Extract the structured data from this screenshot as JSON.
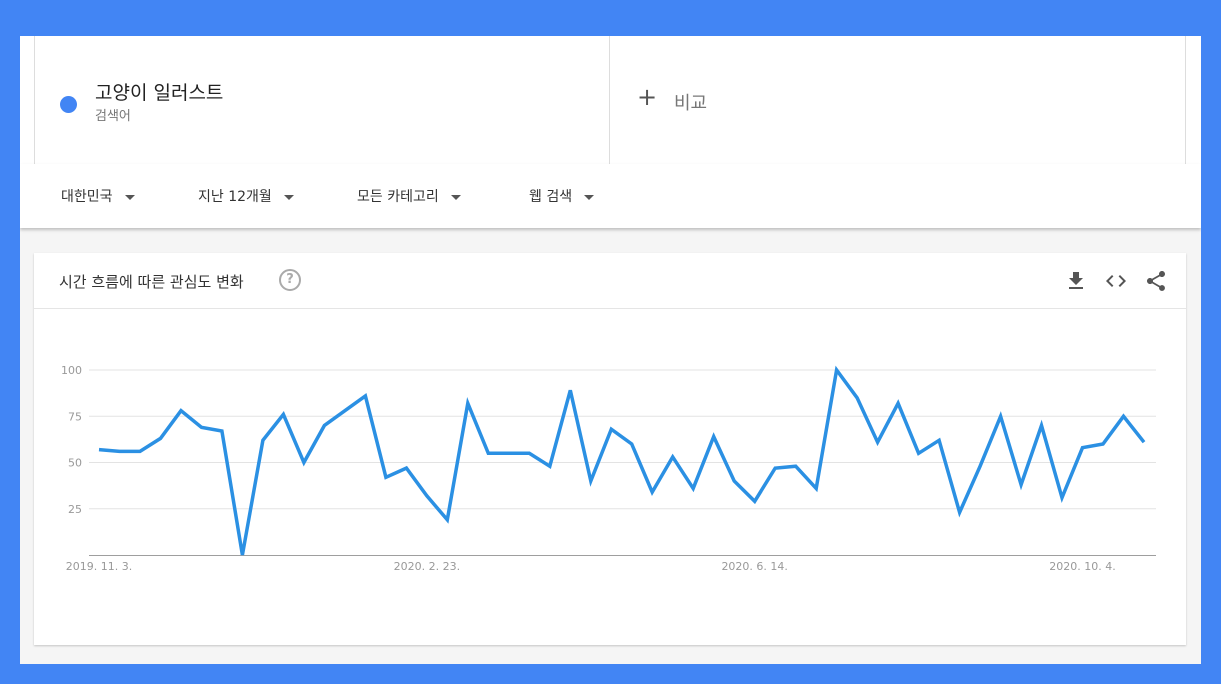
{
  "search_term": {
    "name": "고양이 일러스트",
    "type_label": "검색어",
    "color": "#4285f4"
  },
  "compare": {
    "plus": "+",
    "label": "비교"
  },
  "filters": {
    "region": "대한민국",
    "period": "지난 12개월",
    "category": "모든 카테고리",
    "search_type": "웹 검색"
  },
  "card": {
    "title": "시간 흐름에 따른 관심도 변화",
    "help_glyph": "?",
    "icons": [
      "download-icon",
      "embed-icon",
      "share-icon"
    ]
  },
  "chart_data": {
    "type": "line",
    "title": "",
    "xlabel": "",
    "ylabel": "",
    "ylim": [
      0,
      100
    ],
    "y_ticks": [
      25,
      50,
      75,
      100
    ],
    "x_tick_labels": [
      {
        "index": 0,
        "label": "2019. 11. 3."
      },
      {
        "index": 16,
        "label": "2020. 2. 23."
      },
      {
        "index": 32,
        "label": "2020. 6. 14."
      },
      {
        "index": 48,
        "label": "2020. 10. 4."
      }
    ],
    "grid": true,
    "line_color": "#2b90e3",
    "series": [
      {
        "name": "고양이 일러스트",
        "values": [
          57,
          56,
          56,
          63,
          78,
          69,
          67,
          0,
          62,
          76,
          50,
          70,
          78,
          86,
          42,
          47,
          32,
          19,
          82,
          55,
          55,
          55,
          48,
          89,
          40,
          68,
          60,
          34,
          53,
          36,
          64,
          40,
          29,
          47,
          48,
          36,
          100,
          85,
          61,
          82,
          55,
          62,
          23,
          48,
          75,
          38,
          70,
          31,
          58,
          60,
          75,
          61
        ]
      }
    ]
  }
}
